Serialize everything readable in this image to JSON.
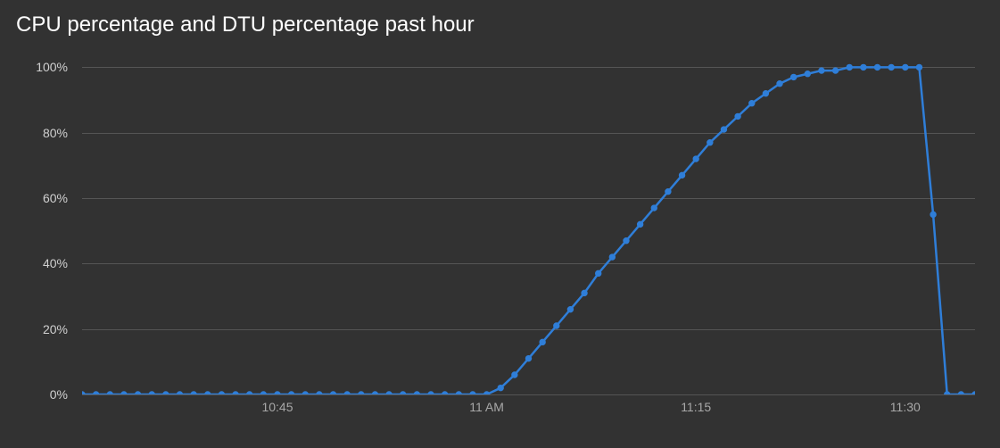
{
  "title": "CPU percentage and DTU percentage past hour",
  "colors": {
    "bg": "#323232",
    "grid": "#555555",
    "line": "#2f7ed8",
    "text": "#ffffff",
    "muted": "#a8a8a8"
  },
  "y_ticks": [
    "100%",
    "80%",
    "60%",
    "40%",
    "20%",
    "0%"
  ],
  "x_ticks": [
    "10:45",
    "11 AM",
    "11:15",
    "11:30"
  ],
  "chart_data": {
    "type": "line",
    "title": "CPU percentage and DTU percentage past hour",
    "xlabel": "",
    "ylabel": "",
    "ylim": [
      0,
      100
    ],
    "xlim_minutes": [
      31,
      95
    ],
    "x_tick_minutes": [
      45,
      60,
      75,
      90
    ],
    "series": [
      {
        "name": "CPU / DTU %",
        "x_minutes": [
          31,
          32,
          33,
          34,
          35,
          36,
          37,
          38,
          39,
          40,
          41,
          42,
          43,
          44,
          45,
          46,
          47,
          48,
          49,
          50,
          51,
          52,
          53,
          54,
          55,
          56,
          57,
          58,
          59,
          60,
          61,
          62,
          63,
          64,
          65,
          66,
          67,
          68,
          69,
          70,
          71,
          72,
          73,
          74,
          75,
          76,
          77,
          78,
          79,
          80,
          81,
          82,
          83,
          84,
          85,
          86,
          87,
          88,
          89,
          90,
          91,
          92,
          93,
          94,
          95
        ],
        "values": [
          0,
          0,
          0,
          0,
          0,
          0,
          0,
          0,
          0,
          0,
          0,
          0,
          0,
          0,
          0,
          0,
          0,
          0,
          0,
          0,
          0,
          0,
          0,
          0,
          0,
          0,
          0,
          0,
          0,
          0,
          2,
          6,
          11,
          16,
          21,
          26,
          31,
          37,
          42,
          47,
          52,
          57,
          62,
          67,
          72,
          77,
          81,
          85,
          89,
          92,
          95,
          97,
          98,
          99,
          99,
          100,
          100,
          100,
          100,
          100,
          100,
          55,
          0,
          0,
          0
        ]
      }
    ]
  }
}
